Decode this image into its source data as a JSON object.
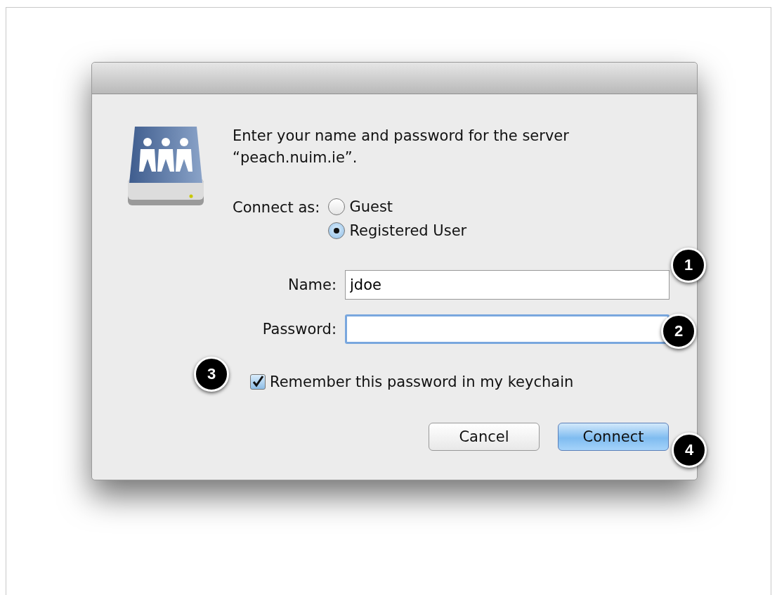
{
  "dialog": {
    "message": "Enter your name and password for the server “peach.nuim.ie”.",
    "connect_as": {
      "label": "Connect as:",
      "options": [
        {
          "label": "Guest",
          "selected": false
        },
        {
          "label": "Registered User",
          "selected": true
        }
      ]
    },
    "fields": [
      {
        "label": "Name:",
        "value": "jdoe",
        "focused": false,
        "callout": "1"
      },
      {
        "label": "Password:",
        "focused": true,
        "callout": "2"
      }
    ],
    "remember": {
      "label": "Remember this password in my keychain",
      "checked": true,
      "callout": "3"
    },
    "buttons": [
      {
        "label": "Cancel",
        "default": false
      },
      {
        "label": "Connect",
        "default": true,
        "callout": "4"
      }
    ]
  }
}
